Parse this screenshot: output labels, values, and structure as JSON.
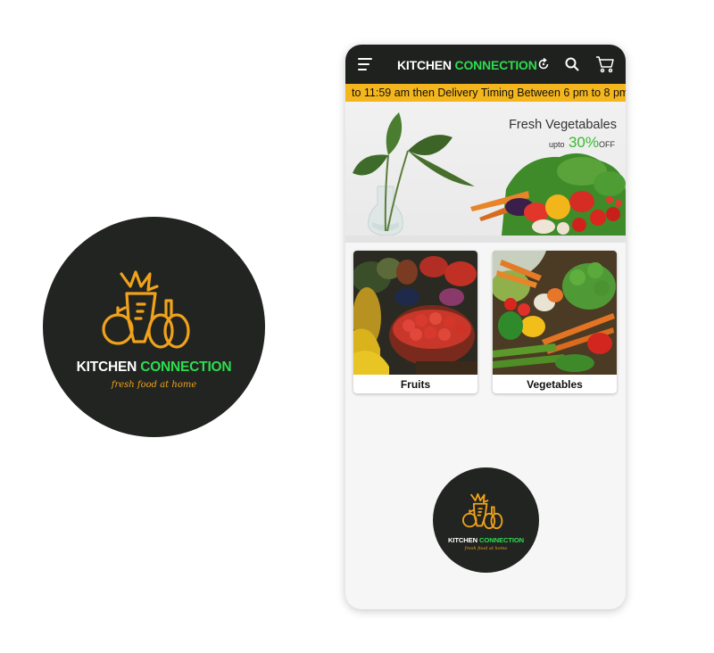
{
  "brand": {
    "name_part1": "KITCHEN",
    "name_part2": "CONNECTION",
    "tagline": "fresh food at home",
    "colors": {
      "dark": "#222421",
      "green": "#2edc50",
      "orange": "#f0a21b"
    }
  },
  "appbar": {
    "menu_icon": "hamburger-menu-icon",
    "title_part1": "KITCHEN",
    "title_part2": "CONNECTION",
    "icons": [
      "refresh-icon",
      "search-icon",
      "cart-icon"
    ]
  },
  "ticker": {
    "text": "to 11:59 am then  Delivery Timing Between 6 pm to 8 pm",
    "color": "#f4b61c"
  },
  "banner": {
    "title": "Fresh Vegetabales",
    "upto": "upto",
    "percent": "30%",
    "off": "OFF"
  },
  "categories": [
    {
      "label": "Fruits"
    },
    {
      "label": "Vegetables"
    }
  ]
}
